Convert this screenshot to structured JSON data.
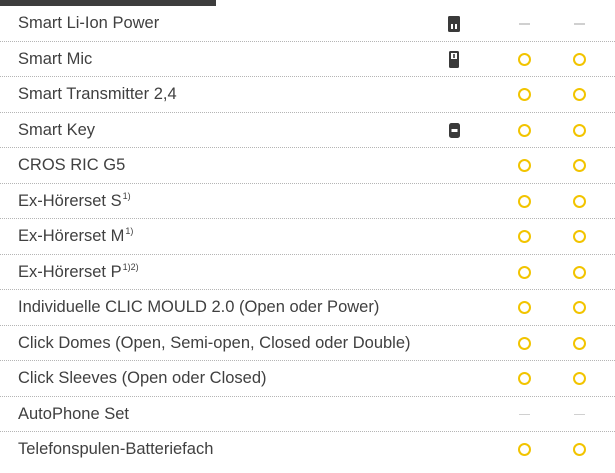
{
  "colors": {
    "circle": "#f2c400",
    "dash": "#d0d0d0",
    "header": "#3d3d3d",
    "text": "#404040"
  },
  "rows": [
    {
      "label": "Smart Li-Ion Power",
      "sup": "",
      "icon": "charger-icon",
      "c1": "dash",
      "c2": "dash"
    },
    {
      "label": "Smart Mic",
      "sup": "",
      "icon": "smart-mic-icon",
      "c1": "circle",
      "c2": "circle"
    },
    {
      "label": "Smart Transmitter 2,4",
      "sup": "",
      "icon": "",
      "c1": "circle",
      "c2": "circle"
    },
    {
      "label": "Smart Key",
      "sup": "",
      "icon": "remote-key-icon",
      "c1": "circle",
      "c2": "circle"
    },
    {
      "label": "CROS RIC G5",
      "sup": "",
      "icon": "",
      "c1": "circle",
      "c2": "circle"
    },
    {
      "label": "Ex-Hörerset S",
      "sup": "1)",
      "icon": "",
      "c1": "circle",
      "c2": "circle"
    },
    {
      "label": "Ex-Hörerset M",
      "sup": "1)",
      "icon": "",
      "c1": "circle",
      "c2": "circle"
    },
    {
      "label": "Ex-Hörerset P",
      "sup": "1)2)",
      "icon": "",
      "c1": "circle",
      "c2": "circle"
    },
    {
      "label": "Individuelle CLIC MOULD 2.0 (Open oder Power)",
      "sup": "",
      "icon": "",
      "c1": "circle",
      "c2": "circle"
    },
    {
      "label": "Click Domes (Open, Semi-open, Closed oder Double)",
      "sup": "",
      "icon": "",
      "c1": "circle",
      "c2": "circle"
    },
    {
      "label": "Click Sleeves (Open oder Closed)",
      "sup": "",
      "icon": "",
      "c1": "circle",
      "c2": "circle"
    },
    {
      "label": "AutoPhone Set",
      "sup": "",
      "icon": "",
      "c1": "dash",
      "c2": "dash"
    },
    {
      "label": "Telefonspulen-Batteriefach",
      "sup": "",
      "icon": "",
      "c1": "circle",
      "c2": "circle"
    }
  ]
}
